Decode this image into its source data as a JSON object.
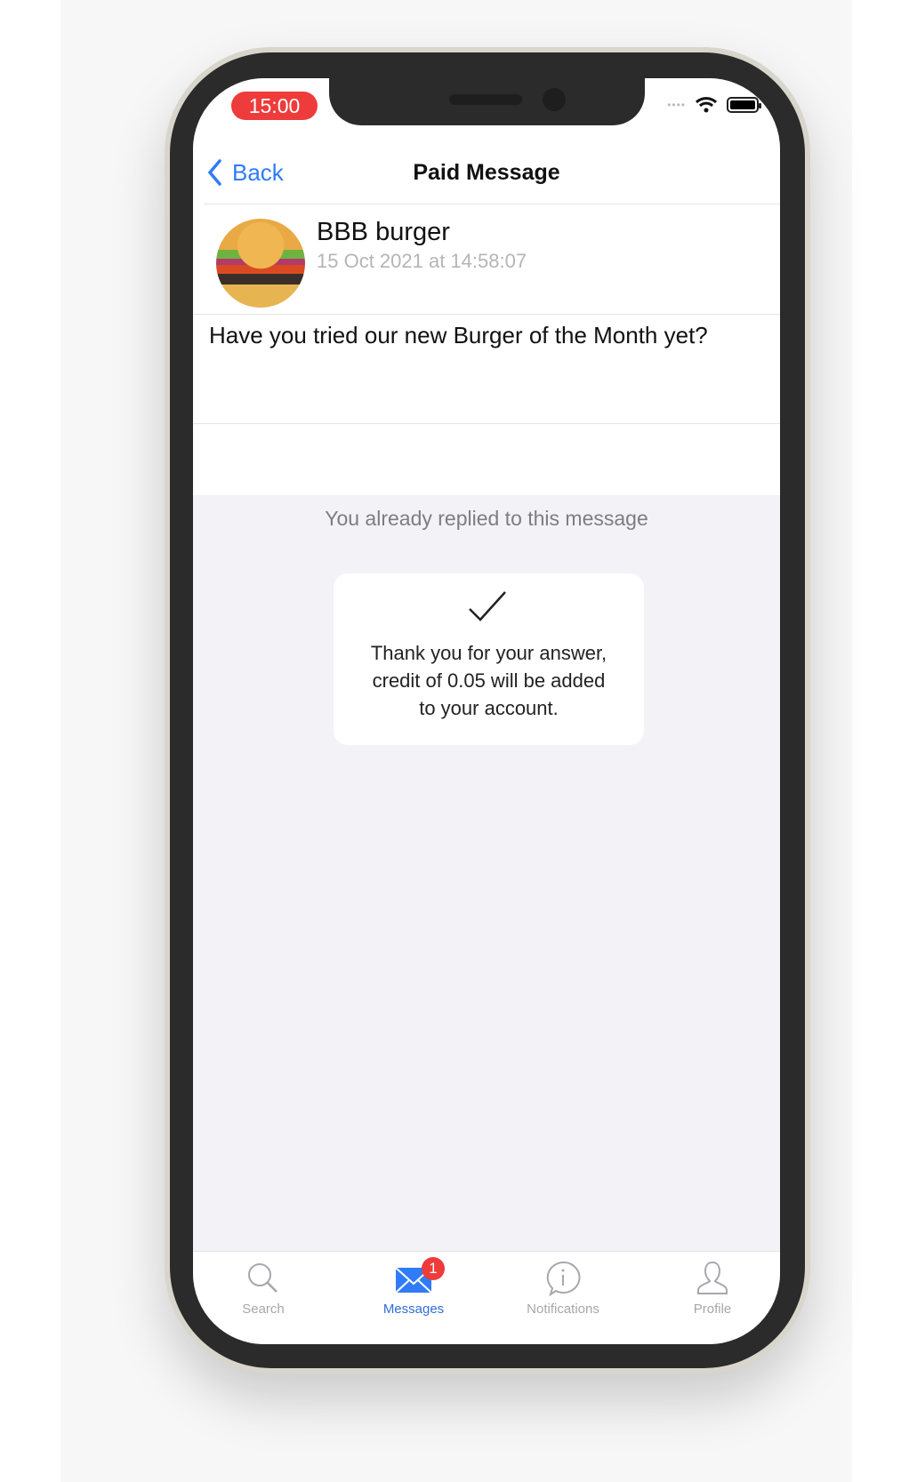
{
  "status_bar": {
    "time": "15:00",
    "icons": [
      "cellular-dots-icon",
      "wifi-icon",
      "battery-icon"
    ]
  },
  "nav": {
    "back_label": "Back",
    "title": "Paid Message"
  },
  "sender": {
    "name": "BBB burger",
    "timestamp": "15 Oct 2021 at 14:58:07",
    "avatar": "burger-photo"
  },
  "message": {
    "text": "Have you tried our new Burger of the Month yet?"
  },
  "reply": {
    "status": "You already replied to this message",
    "confirmation": [
      "Thank you for your answer,",
      "credit of 0.05 will be added",
      "to your account."
    ]
  },
  "tabs": [
    {
      "label": "Search",
      "icon": "search-icon"
    },
    {
      "label": "Messages",
      "icon": "envelope-icon",
      "badge": "1",
      "active": true
    },
    {
      "label": "Notifications",
      "icon": "info-bubble-icon"
    },
    {
      "label": "Profile",
      "icon": "person-icon"
    }
  ],
  "colors": {
    "accent": "#2f7cf6",
    "badge": "#ee3b3b",
    "time_pill": "#ee3b3b"
  }
}
